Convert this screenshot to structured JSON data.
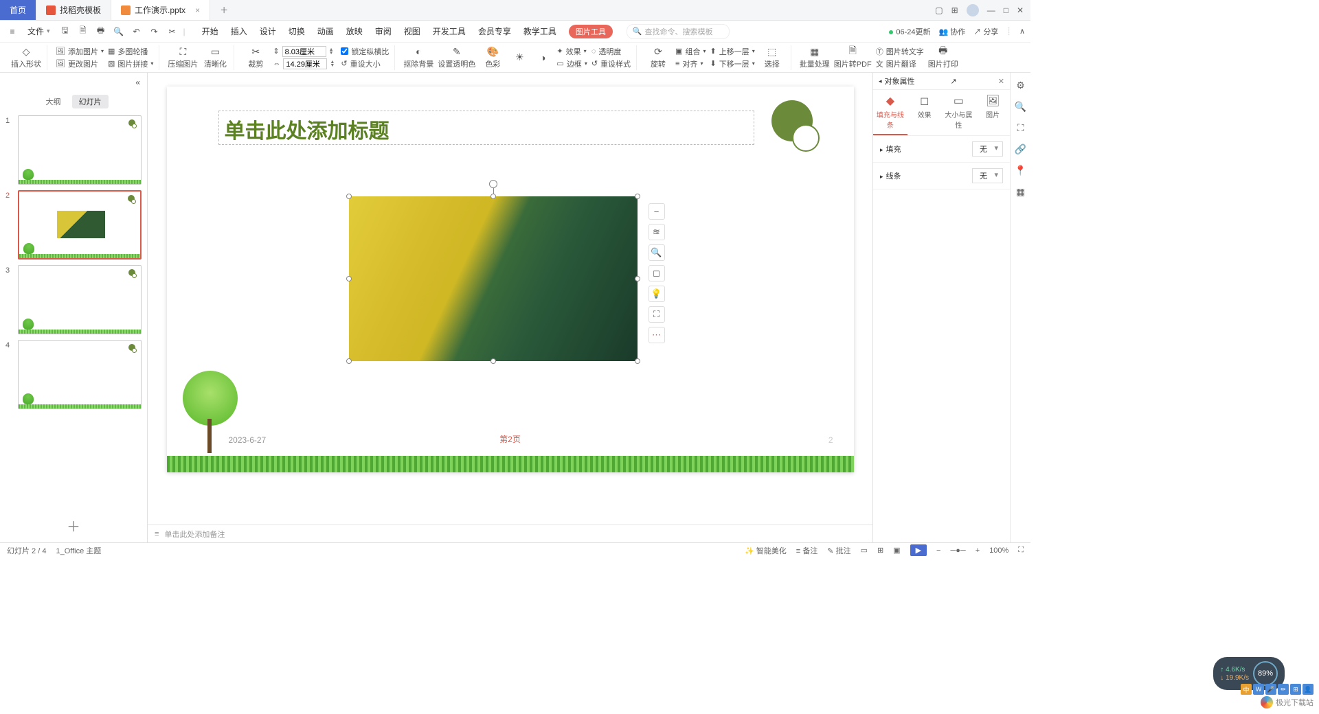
{
  "tabs": {
    "home": "首页",
    "template": "找稻壳模板",
    "doc": "工作演示.pptx"
  },
  "file_menu": "文件",
  "menu_tabs": [
    "开始",
    "插入",
    "设计",
    "切换",
    "动画",
    "放映",
    "审阅",
    "视图",
    "开发工具",
    "会员专享",
    "教学工具"
  ],
  "pill": "图片工具",
  "search_placeholder": "查找命令、搜索模板",
  "top_right": {
    "update": "06-24更新",
    "coop": "协作",
    "share": "分享"
  },
  "ribbon": {
    "insert_shape": "插入形状",
    "add_image": "添加图片",
    "change_image": "更改图片",
    "multi_outline": "多图轮播",
    "image_join": "图片拼接",
    "compress": "压缩图片",
    "sharpen": "清晰化",
    "crop": "裁剪",
    "height": "8.03厘米",
    "width": "14.29厘米",
    "lock_ratio": "锁定纵横比",
    "reset_size": "重设大小",
    "remove_bg": "抠除背景",
    "set_trans_color": "设置透明色",
    "recolor": "色彩",
    "effect": "效果",
    "transparency": "透明度",
    "border": "边框",
    "reset_style": "重设样式",
    "rotate": "旋转",
    "group": "组合",
    "align": "对齐",
    "bring_fwd": "上移一层",
    "send_back": "下移一层",
    "select": "选择",
    "batch": "批量处理",
    "to_pdf": "图片转PDF",
    "to_text": "图片转文字",
    "translate": "图片翻译",
    "print": "图片打印"
  },
  "left_panel": {
    "tabs": {
      "outline": "大纲",
      "slides": "幻灯片"
    },
    "slides": [
      "1",
      "2",
      "3",
      "4"
    ]
  },
  "slide": {
    "title_placeholder": "单击此处添加标题",
    "date": "2023-6-27",
    "page_label": "第2页",
    "page_no": "2"
  },
  "notes_placeholder": "单击此处添加备注",
  "right_panel": {
    "title": "对象属性",
    "tabs": {
      "fill": "填充与线条",
      "effect": "效果",
      "size": "大小与属性",
      "pic": "图片"
    },
    "fill_label": "填充",
    "line_label": "线条",
    "none": "无"
  },
  "status": {
    "slide_pos": "幻灯片 2 / 4",
    "theme": "1_Office 主题",
    "beautify": "智能美化",
    "notes": "备注",
    "comments": "批注",
    "zoom": "100%"
  },
  "speed": {
    "up": "4.6K/s",
    "down": "19.9K/s",
    "pct": "89%"
  },
  "watermark": "极光下载站"
}
